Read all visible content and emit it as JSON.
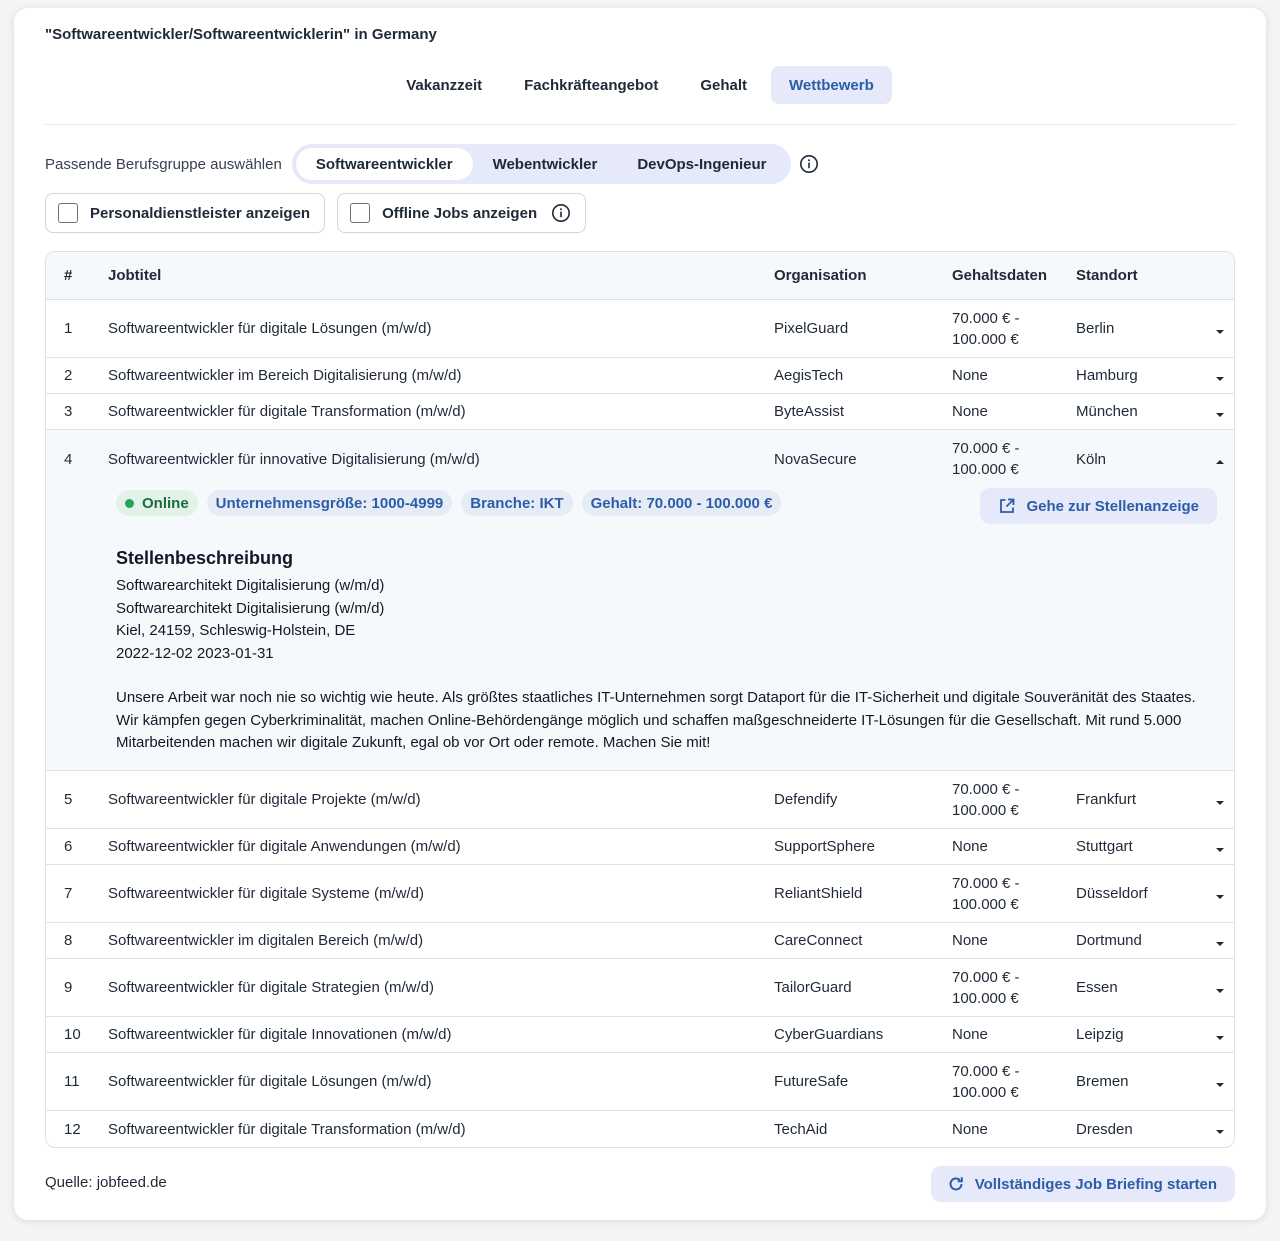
{
  "title": "\"Softwareentwickler/Softwareentwicklerin\" in Germany",
  "tabs": [
    {
      "label": "Vakanzzeit"
    },
    {
      "label": "Fachkräfteangebot"
    },
    {
      "label": "Gehalt"
    },
    {
      "label": "Wettbewerb"
    }
  ],
  "group_selector": {
    "label": "Passende Berufsgruppe auswählen",
    "options": [
      "Softwareentwickler",
      "Webentwickler",
      "DevOps-Ingenieur"
    ],
    "selected": "Softwareentwickler",
    "info_icon": "info-icon"
  },
  "filters": {
    "staffing_label": "Personaldienstleister anzeigen",
    "offline_label": "Offline Jobs anzeigen"
  },
  "table": {
    "headers": {
      "num": "#",
      "title": "Jobtitel",
      "org": "Organisation",
      "salary": "Gehaltsdaten",
      "location": "Standort"
    },
    "rows": [
      {
        "num": "1",
        "title": "Softwareentwickler für digitale Lösungen (m/w/d)",
        "org": "PixelGuard",
        "salary": "70.000 € - 100.000 €",
        "location": "Berlin"
      },
      {
        "num": "2",
        "title": "Softwareentwickler im Bereich Digitalisierung (m/w/d)",
        "org": "AegisTech",
        "salary": "None",
        "location": "Hamburg"
      },
      {
        "num": "3",
        "title": "Softwareentwickler für digitale Transformation (m/w/d)",
        "org": "ByteAssist",
        "salary": "None",
        "location": "München"
      },
      {
        "num": "4",
        "title": "Softwareentwickler für innovative Digitalisierung (m/w/d)",
        "org": "NovaSecure",
        "salary": "70.000 € - 100.000 €",
        "location": "Köln"
      },
      {
        "num": "5",
        "title": "Softwareentwickler für digitale Projekte (m/w/d)",
        "org": "Defendify",
        "salary": "70.000 € - 100.000 €",
        "location": "Frankfurt"
      },
      {
        "num": "6",
        "title": "Softwareentwickler für digitale Anwendungen (m/w/d)",
        "org": "SupportSphere",
        "salary": "None",
        "location": "Stuttgart"
      },
      {
        "num": "7",
        "title": "Softwareentwickler für digitale Systeme (m/w/d)",
        "org": "ReliantShield",
        "salary": "70.000 € - 100.000 €",
        "location": "Düsseldorf"
      },
      {
        "num": "8",
        "title": "Softwareentwickler im digitalen Bereich (m/w/d)",
        "org": "CareConnect",
        "salary": "None",
        "location": "Dortmund"
      },
      {
        "num": "9",
        "title": "Softwareentwickler für digitale Strategien (m/w/d)",
        "org": "TailorGuard",
        "salary": "70.000 € - 100.000 €",
        "location": "Essen"
      },
      {
        "num": "10",
        "title": "Softwareentwickler für digitale Innovationen (m/w/d)",
        "org": "CyberGuardians",
        "salary": "None",
        "location": "Leipzig"
      },
      {
        "num": "11",
        "title": "Softwareentwickler für digitale Lösungen (m/w/d)",
        "org": "FutureSafe",
        "salary": "70.000 € - 100.000 €",
        "location": "Bremen"
      },
      {
        "num": "12",
        "title": "Softwareentwickler für digitale Transformation (m/w/d)",
        "org": "TechAid",
        "salary": "None",
        "location": "Dresden"
      }
    ]
  },
  "expanded": {
    "badges": {
      "online": "Online",
      "size": "Unternehmensgröße: 1000-4999",
      "industry": "Branche: IKT",
      "salary": "Gehalt: 70.000 - 100.000 €"
    },
    "goto_label": "Gehe zur Stellenanzeige",
    "description_heading": "Stellenbeschreibung",
    "lines": [
      "Softwarearchitekt Digitalisierung (w/m/d)",
      "Softwarearchitekt Digitalisierung (w/m/d)",
      "Kiel, 24159, Schleswig-Holstein, DE",
      "2022-12-02 2023-01-31"
    ],
    "body": "Unsere Arbeit war noch nie so wichtig wie heute. Als größtes staatliches IT-Unternehmen sorgt Dataport für die IT-Sicherheit und digitale Souveränität des Staates. Wir kämpfen gegen Cyberkriminalität, machen Online-Behördengänge möglich und schaffen maßgeschneiderte IT-Lösungen für die Gesellschaft. Mit rund 5.000 Mitarbeitenden machen wir digitale Zukunft, egal ob vor Ort oder remote. Machen Sie mit!"
  },
  "footer": {
    "source": "Quelle: jobfeed.de",
    "briefing_label": "Vollständiges Job Briefing starten"
  },
  "colors": {
    "accent": "#2d5da8",
    "accent_bg": "#e5e9f9",
    "online_green": "#22a55a"
  }
}
